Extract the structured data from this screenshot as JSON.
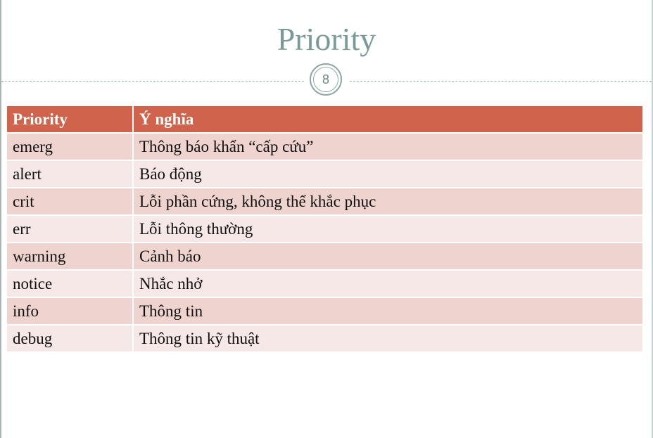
{
  "slide": {
    "title": "Priority",
    "number": "8"
  },
  "table": {
    "headers": [
      "Priority",
      "Ý nghĩa"
    ],
    "rows": [
      [
        "emerg",
        "Thông báo khẩn “cấp cứu”"
      ],
      [
        "alert",
        "Báo động"
      ],
      [
        "crit",
        "Lỗi phần cứng, không thể khắc phục"
      ],
      [
        "err",
        "Lỗi thông thường"
      ],
      [
        "warning",
        "Cảnh báo"
      ],
      [
        "notice",
        "Nhắc nhở"
      ],
      [
        "info",
        "Thông tin"
      ],
      [
        "debug",
        "Thông tin kỹ thuật"
      ]
    ]
  },
  "colors": {
    "title": "#7a9a9a",
    "header_bg": "#d0634b",
    "row_odd_bg": "#eed3ce",
    "row_even_bg": "#f6e8e6"
  }
}
